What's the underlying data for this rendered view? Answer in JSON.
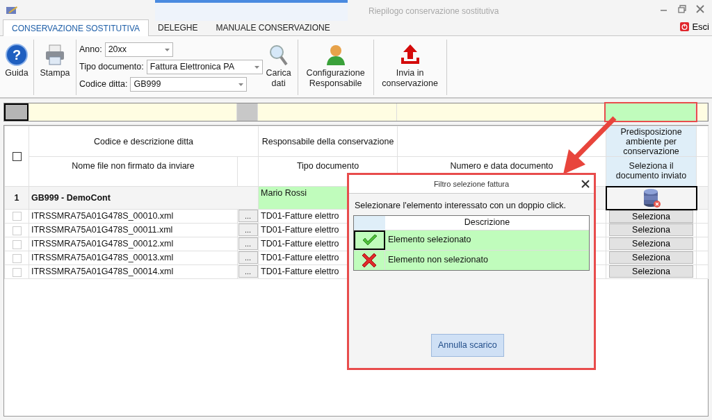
{
  "window": {
    "title": "Riepilogo conservazione sostitutiva"
  },
  "tabs": [
    {
      "label": "CONSERVAZIONE SOSTITUTIVA",
      "selected": true
    },
    {
      "label": "DELEGHE",
      "selected": false
    },
    {
      "label": "MANUALE CONSERVAZIONE",
      "selected": false
    }
  ],
  "exit_button": {
    "label": "Esci"
  },
  "toolbar": {
    "left_buttons": [
      {
        "kind": "help",
        "label": "Guida",
        "icon_text": "?"
      },
      {
        "kind": "print",
        "label": "Stampa"
      }
    ],
    "fields": [
      {
        "label": "Anno:",
        "value": "20xx"
      },
      {
        "label": "Tipo documento:",
        "value": "Fattura Elettronica PA"
      },
      {
        "label": "Codice ditta:",
        "value": "GB999"
      }
    ],
    "right_buttons": [
      {
        "kind": "search",
        "label": "Carica dati"
      },
      {
        "kind": "person",
        "label": "Configurazione Responsabile"
      },
      {
        "kind": "upload",
        "label": "Invia in conservazione"
      }
    ]
  },
  "grid": {
    "select_all": {
      "checked": false
    },
    "header_top": [
      "Codice e descrizione ditta",
      "Responsabile della conservazione",
      "Predisposizione ambiente per conservazione"
    ],
    "header_bottom": [
      "Nome file non firmato da inviare",
      "Tipo documento",
      "Numero e data documento",
      "Seleziona il documento inviato"
    ],
    "groups": [
      {
        "number": "1",
        "company": "GB999 - DemoCont",
        "responsible": "Mario Rossi",
        "rows": [
          {
            "checked": false,
            "file": "ITRSSMRA75A01G478S_00010.xml",
            "more": "...",
            "doc_type": "TD01-Fatture elettro",
            "action": "Seleziona"
          },
          {
            "checked": false,
            "file": "ITRSSMRA75A01G478S_00011.xml",
            "more": "...",
            "doc_type": "TD01-Fatture elettro",
            "action": "Seleziona"
          },
          {
            "checked": false,
            "file": "ITRSSMRA75A01G478S_00012.xml",
            "more": "...",
            "doc_type": "TD01-Fatture elettro",
            "action": "Seleziona"
          },
          {
            "checked": false,
            "file": "ITRSSMRA75A01G478S_00013.xml",
            "more": "...",
            "doc_type": "TD01-Fatture elettro",
            "action": "Seleziona"
          },
          {
            "checked": false,
            "file": "ITRSSMRA75A01G478S_00014.xml",
            "more": "...",
            "doc_type": "TD01-Fatture elettro",
            "action": "Seleziona"
          }
        ]
      }
    ]
  },
  "dialog": {
    "title": "Filtro selezione fattura",
    "instruction": "Selezionare l'elemento interessato con un doppio click.",
    "column": "Descrizione",
    "items": [
      {
        "kind": "check",
        "label": "Elemento selezionato",
        "selected": true
      },
      {
        "kind": "cross",
        "label": "Elemento non selezionato",
        "selected": false
      }
    ],
    "button": "Annulla scarico"
  }
}
